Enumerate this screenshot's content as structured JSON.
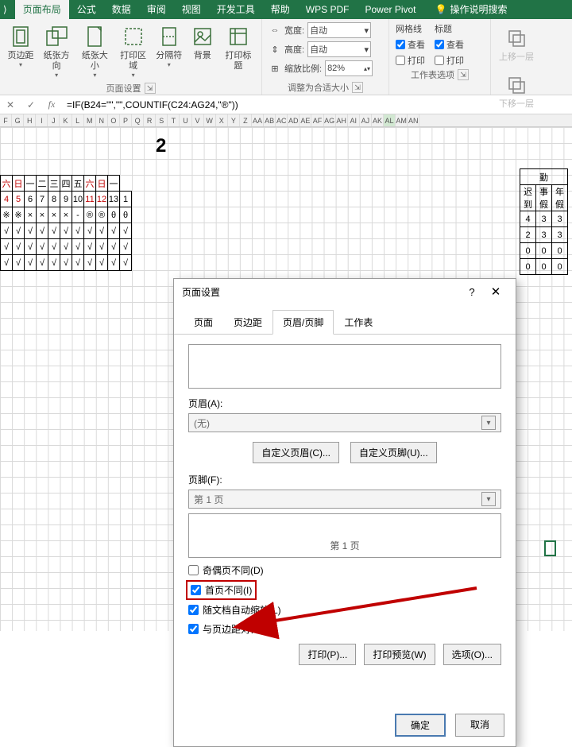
{
  "ribbon": {
    "tabs": [
      "页面布局",
      "公式",
      "数据",
      "审阅",
      "视图",
      "开发工具",
      "帮助",
      "WPS PDF",
      "Power Pivot"
    ],
    "tell_me": "操作说明搜索",
    "page_setup_group": {
      "margins": "页边距",
      "orientation": "纸张方向",
      "size": "纸张大小",
      "print_area": "打印区域",
      "breaks": "分隔符",
      "background": "背景",
      "print_titles": "打印标题",
      "label": "页面设置"
    },
    "scale_group": {
      "width_label": "宽度:",
      "width_value": "自动",
      "height_label": "高度:",
      "height_value": "自动",
      "scale_label": "缩放比例:",
      "scale_value": "82%",
      "label": "调整为合适大小"
    },
    "sheet_options": {
      "gridlines": "网格线",
      "headings": "标题",
      "view": "查看",
      "print": "打印",
      "label": "工作表选项",
      "grid_view": true,
      "grid_print": false,
      "head_view": true,
      "head_print": false
    },
    "arrange": {
      "up": "上移一层",
      "down": "下移一层"
    }
  },
  "formula_bar": {
    "fx": "fx",
    "formula": "=IF(B24=\"\",\"\",COUNTIF(C24:AG24,\"®\"))"
  },
  "columns": [
    "F",
    "G",
    "H",
    "I",
    "J",
    "K",
    "L",
    "M",
    "N",
    "O",
    "P",
    "Q",
    "R",
    "S",
    "T",
    "U",
    "V",
    "W",
    "X",
    "Y",
    "Z",
    "AA",
    "AB",
    "AC",
    "AD",
    "AE",
    "AF",
    "AG",
    "AH",
    "AI",
    "AJ",
    "AK",
    "AL",
    "AM",
    "AN"
  ],
  "selected_col": "AL",
  "title_fragment": "2",
  "attend": {
    "weekdays": [
      "六",
      "日",
      "一",
      "二",
      "三",
      "四",
      "五",
      "六",
      "日",
      "一"
    ],
    "dates": [
      "4",
      "5",
      "6",
      "7",
      "8",
      "9",
      "10",
      "11",
      "12",
      "13",
      "1"
    ],
    "row_sym": [
      "※",
      "※",
      "×",
      "×",
      "×",
      "×",
      "-",
      "®",
      "®",
      "θ",
      "θ"
    ],
    "ticks": [
      "√",
      "√",
      "√",
      "√",
      "√",
      "√",
      "√",
      "√",
      "√",
      "√",
      "√"
    ]
  },
  "right_summary": {
    "header": "勤",
    "cols": [
      "迟到",
      "事假",
      "年假"
    ],
    "rows": [
      [
        "4",
        "3",
        "3"
      ],
      [
        "2",
        "3",
        "3"
      ],
      [
        "0",
        "0",
        "0"
      ],
      [
        "0",
        "0",
        "0"
      ]
    ]
  },
  "dialog": {
    "title": "页面设置",
    "tabs": [
      "页面",
      "页边距",
      "页眉/页脚",
      "工作表"
    ],
    "active_tab": 2,
    "header_label": "页眉(A):",
    "header_value": "(无)",
    "btn_custom_header": "自定义页眉(C)...",
    "btn_custom_footer": "自定义页脚(U)...",
    "footer_label": "页脚(F):",
    "footer_value": "第 1 页",
    "footer_preview": "第  1 页",
    "chk_odd_even": "奇偶页不同(D)",
    "chk_first": "首页不同(I)",
    "chk_scale": "随文档自动缩放(L)",
    "chk_align": "与页边距对齐(M)",
    "chk_odd_even_v": false,
    "chk_first_v": true,
    "chk_scale_v": true,
    "chk_align_v": true,
    "btn_print": "打印(P)...",
    "btn_preview": "打印预览(W)",
    "btn_options": "选项(O)...",
    "ok": "确定",
    "cancel": "取消"
  }
}
